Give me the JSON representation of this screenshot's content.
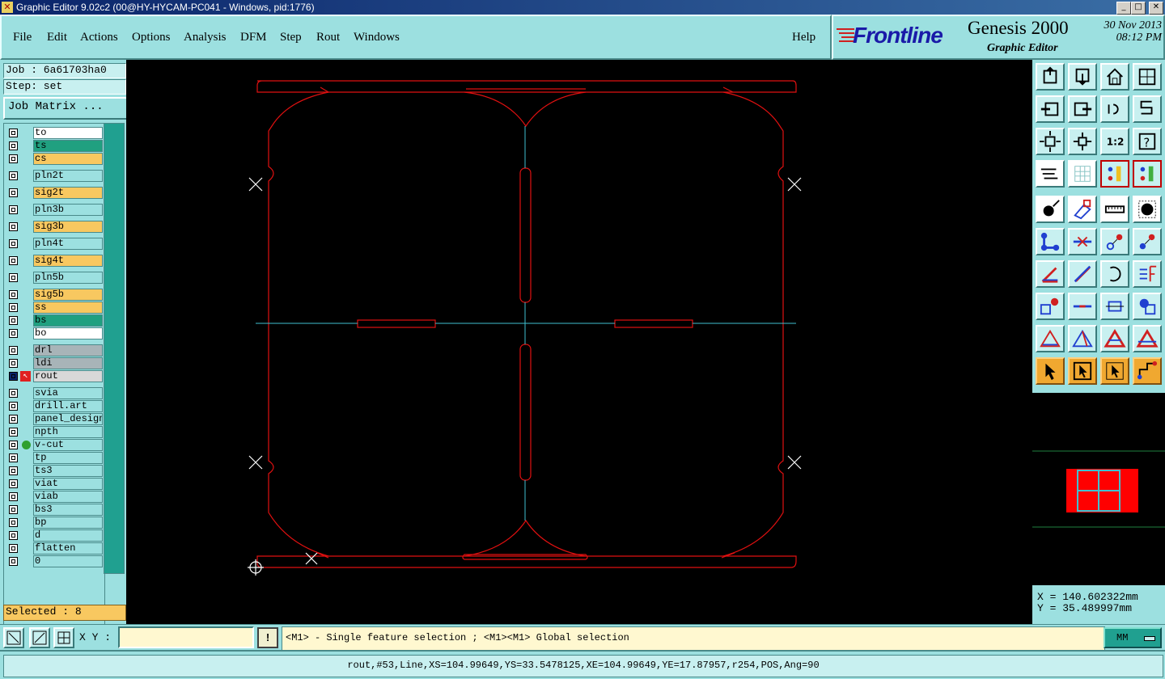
{
  "window": {
    "title": "Graphic Editor 9.02c2 (00@HY-HYCAM-PC041 - Windows, pid:1776)"
  },
  "menu": [
    "File",
    "Edit",
    "Actions",
    "Options",
    "Analysis",
    "DFM",
    "Step",
    "Rout",
    "Windows"
  ],
  "help_label": "Help",
  "brand": {
    "logo": "Frontline",
    "product": "Genesis 2000",
    "subtitle": "Graphic Editor",
    "date": "30 Nov 2013",
    "time": "08:12 PM"
  },
  "job": {
    "job_label": "Job : 6a61703ha0",
    "step_label": "Step: set",
    "matrix_button": "Job Matrix ..."
  },
  "layers": [
    {
      "name": "to",
      "color": "#ffffff"
    },
    {
      "name": "ts",
      "color": "#20a080"
    },
    {
      "name": "cs",
      "color": "#f8c860"
    },
    {
      "name": "pln2t",
      "color": "#9ce0e0"
    },
    {
      "name": "sig2t",
      "color": "#f8c860"
    },
    {
      "name": "pln3b",
      "color": "#9ce0e0"
    },
    {
      "name": "sig3b",
      "color": "#f8c860"
    },
    {
      "name": "pln4t",
      "color": "#9ce0e0"
    },
    {
      "name": "sig4t",
      "color": "#f8c860"
    },
    {
      "name": "pln5b",
      "color": "#9ce0e0"
    },
    {
      "name": "sig5b",
      "color": "#f8c860"
    },
    {
      "name": "ss",
      "color": "#f8c860"
    },
    {
      "name": "bs",
      "color": "#20a080"
    },
    {
      "name": "bo",
      "color": "#ffffff"
    },
    {
      "name": "drl",
      "color": "#a8b4b8"
    },
    {
      "name": "ldi",
      "color": "#a8b4b8"
    },
    {
      "name": "rout",
      "color": "#d8d8d8",
      "work": true
    },
    {
      "name": "svia",
      "color": "#9ce0e0"
    },
    {
      "name": "drill.art",
      "color": "#9ce0e0"
    },
    {
      "name": "panel_design",
      "color": "#9ce0e0"
    },
    {
      "name": "npth",
      "color": "#9ce0e0"
    },
    {
      "name": "v-cut",
      "color": "#9ce0e0",
      "marked": true
    },
    {
      "name": "tp",
      "color": "#9ce0e0"
    },
    {
      "name": "ts3",
      "color": "#9ce0e0"
    },
    {
      "name": "viat",
      "color": "#9ce0e0"
    },
    {
      "name": "viab",
      "color": "#9ce0e0"
    },
    {
      "name": "bs3",
      "color": "#9ce0e0"
    },
    {
      "name": "bp",
      "color": "#9ce0e0"
    },
    {
      "name": "d",
      "color": "#9ce0e0"
    },
    {
      "name": "flatten",
      "color": "#9ce0e0"
    },
    {
      "name": "0",
      "color": "#9ce0e0"
    }
  ],
  "selected": "Selected : 8",
  "coords": {
    "x": "X = 140.602322mm",
    "y": "Y =  35.489997mm"
  },
  "cmd": {
    "xy_label": "X Y :",
    "xy_value": "",
    "excl": "!",
    "message": "<M1> - Single feature selection ; <M1><M1> Global selection",
    "units": "MM"
  },
  "status": "rout,#53,Line,XS=104.99649,YS=33.5478125,XE=104.99649,YE=17.87957,r254,POS,Ang=90",
  "colors": {
    "panel": "#9ce0e0",
    "rout": "#e01010",
    "vcut": "#40c0d0"
  },
  "tools": [
    "home-top-icon",
    "home-bottom-icon",
    "home-icon",
    "window-icon",
    "arrow-left-icon",
    "arrow-right-icon",
    "rotate-left-icon",
    "snake-icon",
    "fit-icon",
    "center-icon",
    "scale-1-2-label",
    "help-icon",
    "measure-tools-icon",
    "grid-icon",
    "layers-color-icon",
    "layers-active-icon",
    "snap-point-icon",
    "snap-shape-icon",
    "ruler-icon",
    "circle-fill-icon",
    "connect-icon",
    "cut-cross-icon",
    "move-point-icon",
    "move-point2-icon",
    "angle-icon",
    "slope-icon",
    "arc-icon",
    "mirror-f-icon",
    "point-box-icon",
    "line-dash-icon",
    "dimension-icon",
    "cluster-icon",
    "triangle-icon",
    "triangle2-icon",
    "triangle-a-icon",
    "triangle-a2-icon",
    "select-arrow-icon",
    "select-arrow-box-icon",
    "select-arrow-box2-icon",
    "route-path-icon"
  ],
  "scale_label": "1:2"
}
